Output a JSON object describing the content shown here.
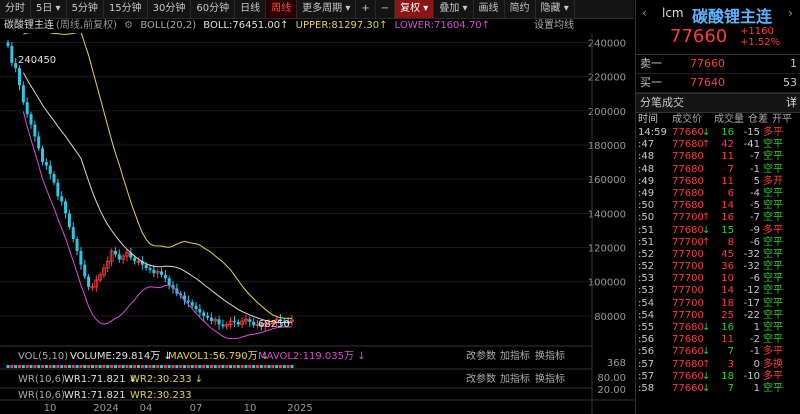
{
  "toolbar": {
    "buttons": [
      "分时",
      "5日 ▾",
      "5分钟",
      "15分钟",
      "30分钟",
      "60分钟",
      "日线",
      "周线",
      "更多周期 ▾",
      "+",
      "−",
      "复权 ▾",
      "叠加 ▾",
      "画线",
      "简约",
      "隐藏 ▾"
    ],
    "active": "周线"
  },
  "info_line": {
    "title": "碳酸锂主连",
    "period_note": "(周线,前复权)",
    "boll": "BOLL(20,2)",
    "boll_val": "BOLL:76451.00↑",
    "upper": "UPPER:81297.30↑",
    "lower": "LOWER:71604.70↑",
    "settings": "设置均线"
  },
  "chart_data": {
    "type": "candlestick",
    "title": "碳酸锂主连",
    "high_label": "240450",
    "low_label": "68250",
    "y_ticks": [
      "240000",
      "220000",
      "200000",
      "180000",
      "160000",
      "140000",
      "120000",
      "100000",
      "80000"
    ],
    "x_ticks": [
      "10",
      "2024",
      "04",
      "07",
      "10",
      "2025"
    ],
    "ylim": [
      70000,
      242000
    ],
    "closes": [
      238000,
      228000,
      225000,
      215000,
      205000,
      198000,
      192000,
      185000,
      178000,
      170000,
      168000,
      163000,
      158000,
      150000,
      147000,
      140000,
      132000,
      125000,
      118000,
      110000,
      103000,
      97000,
      97000,
      101000,
      104000,
      108000,
      112000,
      118000,
      116000,
      113000,
      115000,
      117000,
      114000,
      112000,
      112000,
      110000,
      108000,
      107000,
      105000,
      106000,
      104000,
      102000,
      98000,
      96000,
      93000,
      92000,
      89000,
      88000,
      86000,
      84000,
      82000,
      80000,
      79000,
      77000,
      78000,
      75000,
      74000,
      75000,
      77000,
      76500,
      75000,
      77000,
      78000,
      76500,
      74500,
      75000,
      74000,
      75500,
      75500,
      76000,
      78000,
      77200,
      77000,
      76800,
      77600
    ]
  },
  "sub1": {
    "label": "VOL(5,10)",
    "v1": "VOLUME:29.814万 ↓",
    "v2": "MAVOL1:56.790万 ↓",
    "v3": "MAVOL2:119.035万 ↓",
    "btns": [
      "改参数",
      "加指标",
      "换指标"
    ],
    "scale": "368"
  },
  "sub2": {
    "label": "WR(10,6)",
    "v1": "WR1:71.821 ↓",
    "v2": "WR2:30.233 ↓",
    "btns": [
      "改参数",
      "加指标",
      "换指标"
    ],
    "scale1": "80.00",
    "scale2": "20.00"
  },
  "sub3": {
    "label": "WR(10,6)",
    "v1": "WR1:71.821",
    "v2": "WR2:30.233"
  },
  "quote": {
    "code": "lcm",
    "name": "碳酸锂主连",
    "price": "77660",
    "change": "+1160",
    "pct": "+1.52%",
    "sell_label": "卖一",
    "sell_price": "77660",
    "sell_vol": "1",
    "buy_label": "买一",
    "buy_price": "77640",
    "buy_vol": "53"
  },
  "ticks": {
    "title": "分笔成交",
    "detail": "详",
    "columns": [
      "时间",
      "成交价",
      "成交量",
      "仓差",
      "开平"
    ],
    "rows": [
      {
        "t": "14:59",
        "p": "77660",
        "d": "↓",
        "v": "16",
        "o": "-15",
        "k": "多平"
      },
      {
        "t": ":47",
        "p": "77680",
        "d": "↑",
        "v": "42",
        "o": "-41",
        "k": "空平"
      },
      {
        "t": ":48",
        "p": "77680",
        "d": "",
        "v": "11",
        "o": "-7",
        "k": "空平"
      },
      {
        "t": ":48",
        "p": "77680",
        "d": "",
        "v": "7",
        "o": "-1",
        "k": "空平"
      },
      {
        "t": ":49",
        "p": "77680",
        "d": "",
        "v": "11",
        "o": "5",
        "k": "多开"
      },
      {
        "t": ":49",
        "p": "77680",
        "d": "",
        "v": "6",
        "o": "-4",
        "k": "空平"
      },
      {
        "t": ":50",
        "p": "77680",
        "d": "",
        "v": "14",
        "o": "-5",
        "k": "空平"
      },
      {
        "t": ":50",
        "p": "77700",
        "d": "↑",
        "v": "16",
        "o": "-7",
        "k": "空平"
      },
      {
        "t": ":51",
        "p": "77680",
        "d": "↓",
        "v": "15",
        "o": "-9",
        "k": "多平"
      },
      {
        "t": ":51",
        "p": "77700",
        "d": "↑",
        "v": "8",
        "o": "-6",
        "k": "空平"
      },
      {
        "t": ":52",
        "p": "77700",
        "d": "",
        "v": "45",
        "o": "-32",
        "k": "空平"
      },
      {
        "t": ":52",
        "p": "77700",
        "d": "",
        "v": "36",
        "o": "-32",
        "k": "空平"
      },
      {
        "t": ":53",
        "p": "77700",
        "d": "",
        "v": "10",
        "o": "-6",
        "k": "空平"
      },
      {
        "t": ":53",
        "p": "77700",
        "d": "",
        "v": "14",
        "o": "-12",
        "k": "空平"
      },
      {
        "t": ":54",
        "p": "77700",
        "d": "",
        "v": "18",
        "o": "-17",
        "k": "空平"
      },
      {
        "t": ":54",
        "p": "77700",
        "d": "",
        "v": "25",
        "o": "-22",
        "k": "空平"
      },
      {
        "t": ":55",
        "p": "77680",
        "d": "↓",
        "v": "16",
        "o": "1",
        "k": "空平"
      },
      {
        "t": ":56",
        "p": "77680",
        "d": "",
        "v": "11",
        "o": "-2",
        "k": "空平"
      },
      {
        "t": ":56",
        "p": "77660",
        "d": "↓",
        "v": "7",
        "o": "-1",
        "k": "多平"
      },
      {
        "t": ":57",
        "p": "77680",
        "d": "↑",
        "v": "3",
        "o": "0",
        "k": "多换"
      },
      {
        "t": ":57",
        "p": "77660",
        "d": "↓",
        "v": "18",
        "o": "-10",
        "k": "多平"
      },
      {
        "t": ":58",
        "p": "77660",
        "d": "↓",
        "v": "7",
        "o": "1",
        "k": "空平"
      }
    ]
  },
  "colors": {
    "up": "#ff3b3b",
    "down": "#29d329",
    "boll_mid": "#d9d9d9",
    "boll_up": "#e8d24a",
    "boll_low": "#d84bd8",
    "accent": "#5db5ff"
  }
}
